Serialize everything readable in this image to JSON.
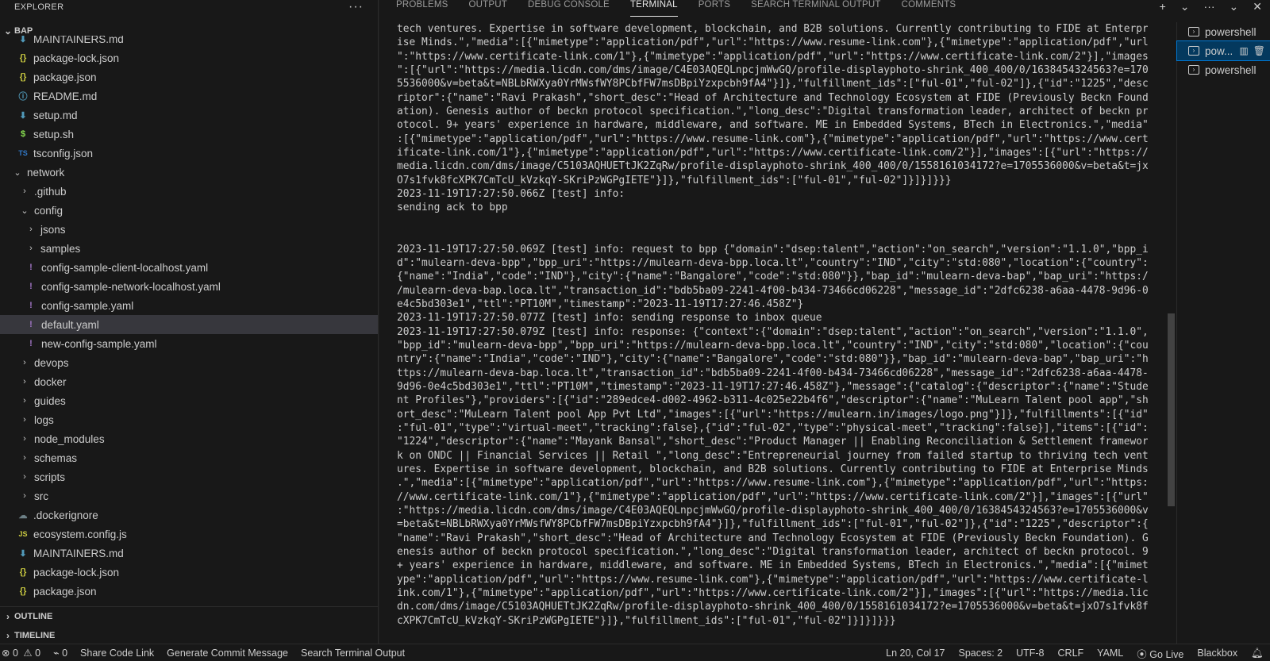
{
  "explorer": {
    "title": "EXPLORER",
    "more": "···",
    "root": "BAP",
    "items": [
      {
        "label": "MAINTAINERS.md",
        "icon": "markdown-icon",
        "glyph": "⬇",
        "cls": "ic-md",
        "indent": 1,
        "type": "file"
      },
      {
        "label": "package-lock.json",
        "icon": "json-icon",
        "glyph": "{}",
        "cls": "ic-json",
        "indent": 1,
        "type": "file"
      },
      {
        "label": "package.json",
        "icon": "json-icon",
        "glyph": "{}",
        "cls": "ic-json",
        "indent": 1,
        "type": "file"
      },
      {
        "label": "README.md",
        "icon": "info-icon",
        "glyph": "ⓘ",
        "cls": "ic-info",
        "indent": 1,
        "type": "file"
      },
      {
        "label": "setup.md",
        "icon": "markdown-icon",
        "glyph": "⬇",
        "cls": "ic-md",
        "indent": 1,
        "type": "file"
      },
      {
        "label": "setup.sh",
        "icon": "shell-icon",
        "glyph": "$",
        "cls": "ic-sh",
        "indent": 1,
        "type": "file"
      },
      {
        "label": "tsconfig.json",
        "icon": "typescript-icon",
        "glyph": "TS",
        "cls": "ic-ts",
        "indent": 1,
        "type": "file"
      },
      {
        "label": "network",
        "icon": "chevron-down-icon",
        "indent": 1,
        "type": "folder-open"
      },
      {
        "label": ".github",
        "icon": "chevron-right-icon",
        "indent": 2,
        "type": "folder"
      },
      {
        "label": "config",
        "icon": "chevron-down-icon",
        "indent": 2,
        "type": "folder-open"
      },
      {
        "label": "jsons",
        "icon": "chevron-right-icon",
        "indent": 3,
        "type": "folder"
      },
      {
        "label": "samples",
        "icon": "chevron-right-icon",
        "indent": 3,
        "type": "folder"
      },
      {
        "label": "config-sample-client-localhost.yaml",
        "icon": "yaml-icon",
        "glyph": "!",
        "cls": "ic-yaml",
        "indent": 3,
        "type": "file"
      },
      {
        "label": "config-sample-network-localhost.yaml",
        "icon": "yaml-icon",
        "glyph": "!",
        "cls": "ic-yaml",
        "indent": 3,
        "type": "file"
      },
      {
        "label": "config-sample.yaml",
        "icon": "yaml-icon",
        "glyph": "!",
        "cls": "ic-yaml",
        "indent": 3,
        "type": "file"
      },
      {
        "label": "default.yaml",
        "icon": "yaml-icon",
        "glyph": "!",
        "cls": "ic-yaml",
        "indent": 3,
        "type": "file",
        "selected": true
      },
      {
        "label": "new-config-sample.yaml",
        "icon": "yaml-icon",
        "glyph": "!",
        "cls": "ic-yaml",
        "indent": 3,
        "type": "file"
      },
      {
        "label": "devops",
        "icon": "chevron-right-icon",
        "indent": 2,
        "type": "folder"
      },
      {
        "label": "docker",
        "icon": "chevron-right-icon",
        "indent": 2,
        "type": "folder"
      },
      {
        "label": "guides",
        "icon": "chevron-right-icon",
        "indent": 2,
        "type": "folder"
      },
      {
        "label": "logs",
        "icon": "chevron-right-icon",
        "indent": 2,
        "type": "folder"
      },
      {
        "label": "node_modules",
        "icon": "chevron-right-icon",
        "indent": 2,
        "type": "folder"
      },
      {
        "label": "schemas",
        "icon": "chevron-right-icon",
        "indent": 2,
        "type": "folder"
      },
      {
        "label": "scripts",
        "icon": "chevron-right-icon",
        "indent": 2,
        "type": "folder"
      },
      {
        "label": "src",
        "icon": "chevron-right-icon",
        "indent": 2,
        "type": "folder"
      },
      {
        "label": ".dockerignore",
        "icon": "docker-icon",
        "glyph": "☁",
        "cls": "ic-docker",
        "indent": 1,
        "type": "file"
      },
      {
        "label": "ecosystem.config.js",
        "icon": "javascript-icon",
        "glyph": "JS",
        "cls": "ic-js",
        "indent": 1,
        "type": "file"
      },
      {
        "label": "MAINTAINERS.md",
        "icon": "markdown-icon",
        "glyph": "⬇",
        "cls": "ic-md",
        "indent": 1,
        "type": "file"
      },
      {
        "label": "package-lock.json",
        "icon": "json-icon",
        "glyph": "{}",
        "cls": "ic-json",
        "indent": 1,
        "type": "file"
      },
      {
        "label": "package.json",
        "icon": "json-icon",
        "glyph": "{}",
        "cls": "ic-json",
        "indent": 1,
        "type": "file"
      },
      {
        "label": "README.md",
        "icon": "info-icon",
        "glyph": "ⓘ",
        "cls": "ic-info",
        "indent": 1,
        "type": "file"
      }
    ],
    "outline": "OUTLINE",
    "timeline": "TIMELINE"
  },
  "panel": {
    "tabs": [
      "PROBLEMS",
      "OUTPUT",
      "DEBUG CONSOLE",
      "TERMINAL",
      "PORTS",
      "SEARCH TERMINAL OUTPUT",
      "COMMENTS"
    ],
    "active_tab": "TERMINAL",
    "actions": {
      "add": "+",
      "dropdown": "⌄",
      "more": "···",
      "collapse": "⌄",
      "close": "✕"
    }
  },
  "terminal": {
    "lines": [
      "tech ventures. Expertise in software development, blockchain, and B2B solutions. Currently contributing to FIDE at Enterpr",
      "ise Minds.\",\"media\":[{\"mimetype\":\"application/pdf\",\"url\":\"https://www.resume-link.com\"},{\"mimetype\":\"application/pdf\",\"url",
      "\":\"https://www.certificate-link.com/1\"},{\"mimetype\":\"application/pdf\",\"url\":\"https://www.certificate-link.com/2\"}],\"images",
      "\":[{\"url\":\"https://media.licdn.com/dms/image/C4E03AQEQLnpcjmWwGQ/profile-displayphoto-shrink_400_400/0/1638454324563?e=170",
      "5536000&v=beta&t=NBLbRWXya0YrMWsfWY8PCbfFW7msDBpiYzxpcbh9fA4\"}]},\"fulfillment_ids\":[\"ful-01\",\"ful-02\"]},{\"id\":\"1225\",\"desc",
      "riptor\":{\"name\":\"Ravi Prakash\",\"short_desc\":\"Head of Architecture and Technology Ecosystem at FIDE (Previously Beckn Found",
      "ation). Genesis author of beckn protocol specification.\",\"long_desc\":\"Digital transformation leader, architect of beckn pr",
      "otocol. 9+ years' experience in hardware, middleware, and software. ME in Embedded Systems, BTech in Electronics.\",\"media\"",
      ":[{\"mimetype\":\"application/pdf\",\"url\":\"https://www.resume-link.com\"},{\"mimetype\":\"application/pdf\",\"url\":\"https://www.cert",
      "ificate-link.com/1\"},{\"mimetype\":\"application/pdf\",\"url\":\"https://www.certificate-link.com/2\"}],\"images\":[{\"url\":\"https://",
      "media.licdn.com/dms/image/C5103AQHUETtJK2ZqRw/profile-displayphoto-shrink_400_400/0/1558161034172?e=1705536000&v=beta&t=jx",
      "O7s1fvk8fcXPK7CmTcU_kVzkqY-SKriPzWGPgIETE\"}]},\"fulfillment_ids\":[\"ful-01\",\"ful-02\"]}]}]}}}",
      "2023-11-19T17:27:50.066Z [test] info:",
      "sending ack to bpp",
      "",
      "",
      "2023-11-19T17:27:50.069Z [test] info: request to bpp {\"domain\":\"dsep:talent\",\"action\":\"on_search\",\"version\":\"1.1.0\",\"bpp_i",
      "d\":\"mulearn-deva-bpp\",\"bpp_uri\":\"https://mulearn-deva-bpp.loca.lt\",\"country\":\"IND\",\"city\":\"std:080\",\"location\":{\"country\":",
      "{\"name\":\"India\",\"code\":\"IND\"},\"city\":{\"name\":\"Bangalore\",\"code\":\"std:080\"}},\"bap_id\":\"mulearn-deva-bap\",\"bap_uri\":\"https:/",
      "/mulearn-deva-bap.loca.lt\",\"transaction_id\":\"bdb5ba09-2241-4f00-b434-73466cd06228\",\"message_id\":\"2dfc6238-a6aa-4478-9d96-0",
      "e4c5bd303e1\",\"ttl\":\"PT10M\",\"timestamp\":\"2023-11-19T17:27:46.458Z\"}",
      "2023-11-19T17:27:50.077Z [test] info: sending response to inbox queue",
      "2023-11-19T17:27:50.079Z [test] info: response: {\"context\":{\"domain\":\"dsep:talent\",\"action\":\"on_search\",\"version\":\"1.1.0\",",
      "\"bpp_id\":\"mulearn-deva-bpp\",\"bpp_uri\":\"https://mulearn-deva-bpp.loca.lt\",\"country\":\"IND\",\"city\":\"std:080\",\"location\":{\"cou",
      "ntry\":{\"name\":\"India\",\"code\":\"IND\"},\"city\":{\"name\":\"Bangalore\",\"code\":\"std:080\"}},\"bap_id\":\"mulearn-deva-bap\",\"bap_uri\":\"h",
      "ttps://mulearn-deva-bap.loca.lt\",\"transaction_id\":\"bdb5ba09-2241-4f00-b434-73466cd06228\",\"message_id\":\"2dfc6238-a6aa-4478-",
      "9d96-0e4c5bd303e1\",\"ttl\":\"PT10M\",\"timestamp\":\"2023-11-19T17:27:46.458Z\"},\"message\":{\"catalog\":{\"descriptor\":{\"name\":\"Stude",
      "nt Profiles\"},\"providers\":[{\"id\":\"289edce4-d002-4962-b311-4c025e22b4f6\",\"descriptor\":{\"name\":\"MuLearn Talent pool app\",\"sh",
      "ort_desc\":\"MuLearn Talent pool App Pvt Ltd\",\"images\":[{\"url\":\"https://mulearn.in/images/logo.png\"}]},\"fulfillments\":[{\"id\"",
      ":\"ful-01\",\"type\":\"virtual-meet\",\"tracking\":false},{\"id\":\"ful-02\",\"type\":\"physical-meet\",\"tracking\":false}],\"items\":[{\"id\":",
      "\"1224\",\"descriptor\":{\"name\":\"Mayank Bansal\",\"short_desc\":\"Product Manager || Enabling Reconciliation & Settlement framewor",
      "k on ONDC || Financial Services || Retail \",\"long_desc\":\"Entrepreneurial journey from failed startup to thriving tech vent",
      "ures. Expertise in software development, blockchain, and B2B solutions. Currently contributing to FIDE at Enterprise Minds",
      ".\",\"media\":[{\"mimetype\":\"application/pdf\",\"url\":\"https://www.resume-link.com\"},{\"mimetype\":\"application/pdf\",\"url\":\"https:",
      "//www.certificate-link.com/1\"},{\"mimetype\":\"application/pdf\",\"url\":\"https://www.certificate-link.com/2\"}],\"images\":[{\"url\"",
      ":\"https://media.licdn.com/dms/image/C4E03AQEQLnpcjmWwGQ/profile-displayphoto-shrink_400_400/0/1638454324563?e=1705536000&v",
      "=beta&t=NBLbRWXya0YrMWsfWY8PCbfFW7msDBpiYzxpcbh9fA4\"}]},\"fulfillment_ids\":[\"ful-01\",\"ful-02\"]},{\"id\":\"1225\",\"descriptor\":{",
      "\"name\":\"Ravi Prakash\",\"short_desc\":\"Head of Architecture and Technology Ecosystem at FIDE (Previously Beckn Foundation). G",
      "enesis author of beckn protocol specification.\",\"long_desc\":\"Digital transformation leader, architect of beckn protocol. 9",
      "+ years' experience in hardware, middleware, and software. ME in Embedded Systems, BTech in Electronics.\",\"media\":[{\"mimet",
      "ype\":\"application/pdf\",\"url\":\"https://www.resume-link.com\"},{\"mimetype\":\"application/pdf\",\"url\":\"https://www.certificate-l",
      "ink.com/1\"},{\"mimetype\":\"application/pdf\",\"url\":\"https://www.certificate-link.com/2\"}],\"images\":[{\"url\":\"https://media.lic",
      "dn.com/dms/image/C5103AQHUETtJK2ZqRw/profile-displayphoto-shrink_400_400/0/1558161034172?e=1705536000&v=beta&t=jxO7s1fvk8f",
      "cXPK7CmTcU_kVzkqY-SKriPzWGPgIETE\"}]},\"fulfillment_ids\":[\"ful-01\",\"ful-02\"]}]}]}}}"
    ]
  },
  "terminal_list": {
    "items": [
      {
        "label": "powershell",
        "active": false
      },
      {
        "label": "pow...",
        "active": true
      },
      {
        "label": "powershell",
        "active": false
      }
    ]
  },
  "statusbar": {
    "errors": "0",
    "warnings": "0",
    "ports": "0",
    "left_items": [
      "Share Code Link",
      "Generate Commit Message",
      "Search Terminal Output"
    ],
    "cursor": "Ln 20, Col 17",
    "spaces": "Spaces: 2",
    "encoding": "UTF-8",
    "eol": "CRLF",
    "language": "YAML",
    "golive": "Go Live",
    "blackbox": "Blackbox"
  }
}
